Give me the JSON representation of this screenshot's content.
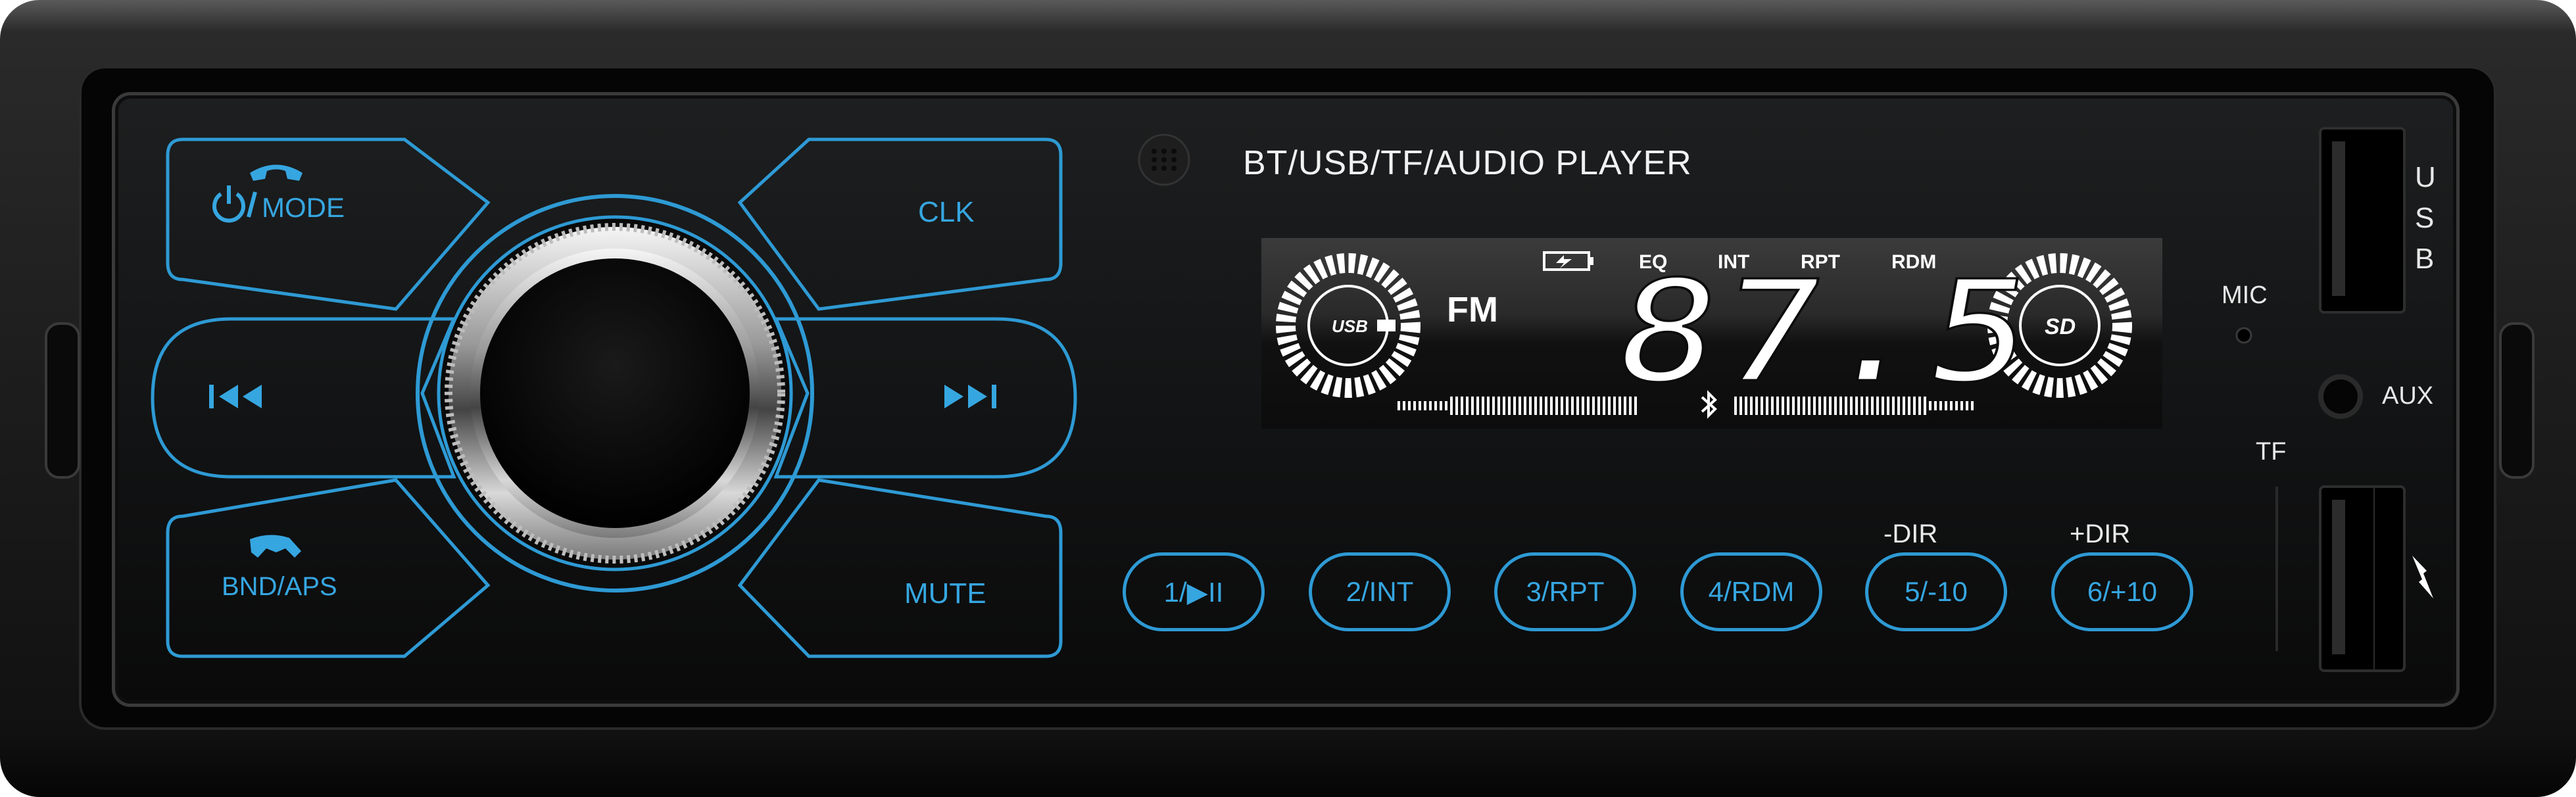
{
  "device": {
    "title": "BT/USB/TF/AUDIO  PLAYER",
    "mic_label": "MIC",
    "aux_label": "AUX",
    "tf_label": "TF",
    "usb_port_label": [
      "U",
      "S",
      "B"
    ]
  },
  "touch_keys": {
    "mode": "MODE",
    "clk": "CLK",
    "prev_icon": "skip-previous-icon",
    "next_icon": "skip-next-icon",
    "bnd_aps": "BND/APS",
    "mute": "MUTE"
  },
  "display": {
    "band": "FM",
    "frequency": "87.5",
    "indicators": {
      "eq": "EQ",
      "int": "INT",
      "rpt": "RPT",
      "rdm": "RDM"
    },
    "usb_indicator": "USB",
    "sd_indicator": "SD"
  },
  "preset_buttons": [
    {
      "label": "1/▶II",
      "top_label": ""
    },
    {
      "label": "2/INT",
      "top_label": ""
    },
    {
      "label": "3/RPT",
      "top_label": ""
    },
    {
      "label": "4/RDM",
      "top_label": ""
    },
    {
      "label": "5/-10",
      "top_label": "-DIR"
    },
    {
      "label": "6/+10",
      "top_label": "+DIR"
    }
  ],
  "colors": {
    "accent_blue": "#36a6e0",
    "face_black": "#111213",
    "lcd_white": "#ffffff"
  }
}
